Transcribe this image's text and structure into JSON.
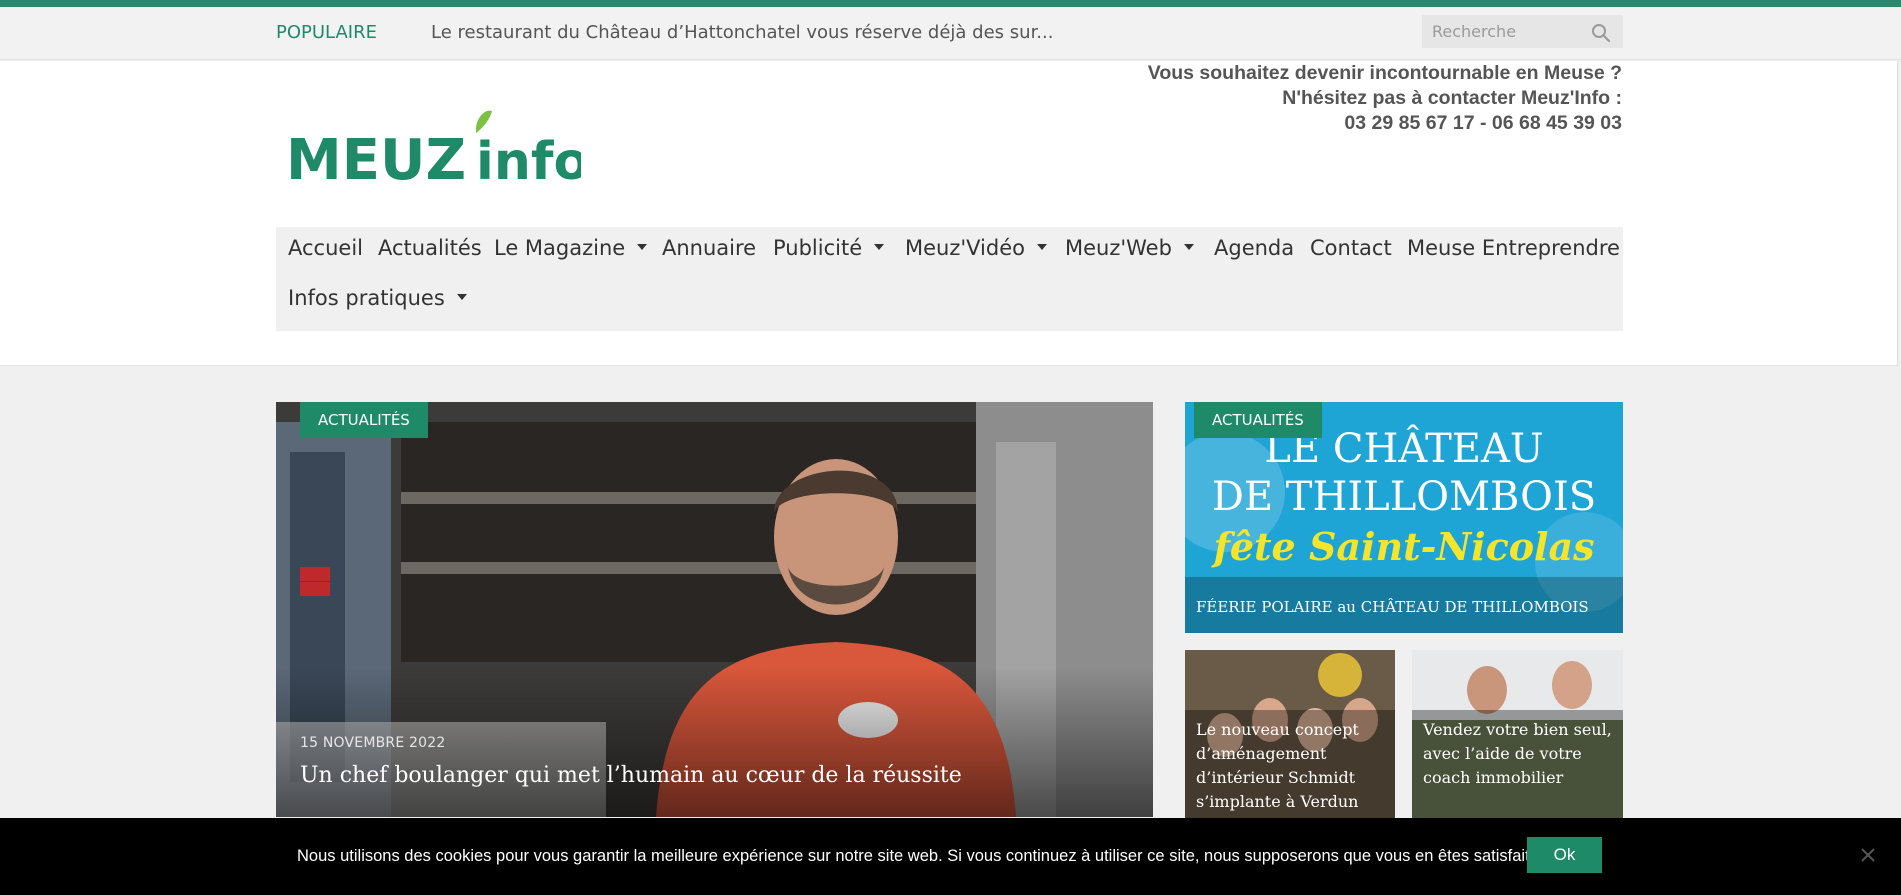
{
  "topbar": {
    "popular_label": "POPULAIRE",
    "ticker_text": "Le restaurant du Château d’Hattonchatel vous réserve déjà des sur...",
    "search_placeholder": "Recherche"
  },
  "header": {
    "logo_text_main": "MEUZ",
    "logo_text_sub": "info",
    "contact_line1": "Vous souhaitez devenir incontournable en Meuse ?",
    "contact_line2": "N'hésitez pas à contacter Meuz'Info :",
    "contact_line3": "03 29 85 67 17 - 06 68 45 39 03"
  },
  "nav": {
    "items": [
      {
        "label": "Accueil",
        "dropdown": false
      },
      {
        "label": "Actualités",
        "dropdown": false
      },
      {
        "label": "Le Magazine",
        "dropdown": true
      },
      {
        "label": "Annuaire",
        "dropdown": false
      },
      {
        "label": "Publicité",
        "dropdown": true
      },
      {
        "label": "Meuz'Vidéo",
        "dropdown": true
      },
      {
        "label": "Meuz'Web",
        "dropdown": true
      },
      {
        "label": "Agenda",
        "dropdown": false
      },
      {
        "label": "Contact",
        "dropdown": false
      },
      {
        "label": "Meuse Entreprendre",
        "dropdown": false
      },
      {
        "label": "Infos pratiques",
        "dropdown": true
      }
    ]
  },
  "hero": {
    "tag": "ACTUALITÉS",
    "date": "15 NOVEMBRE 2022",
    "title": "Un chef boulanger qui met l’humain au cœur de la réussite"
  },
  "side_top": {
    "tag": "ACTUALITÉS",
    "banner_line1": "LE CHÂTEAU",
    "banner_line2": "DE THILLOMBOIS",
    "banner_line3": "fête Saint-Nicolas",
    "title": "FÉERIE POLAIRE au CHÂTEAU DE THILLOMBOIS"
  },
  "cards": [
    {
      "title": "Le nouveau concept d’aménagement d’intérieur Schmidt s’implante à Verdun"
    },
    {
      "title": "Vendez votre bien seul, avec l’aide de votre coach immobilier"
    }
  ],
  "cookie": {
    "message": "Nous utilisons des cookies pour vous garantir la meilleure expérience sur notre site web. Si vous continuez à utiliser ce site, nous supposerons que vous en êtes satisfait.",
    "ok_label": "Ok"
  },
  "colors": {
    "brand_green": "#1e8a68",
    "accent_bar": "#2b8a6e",
    "logo_light_green": "#7cc242"
  }
}
